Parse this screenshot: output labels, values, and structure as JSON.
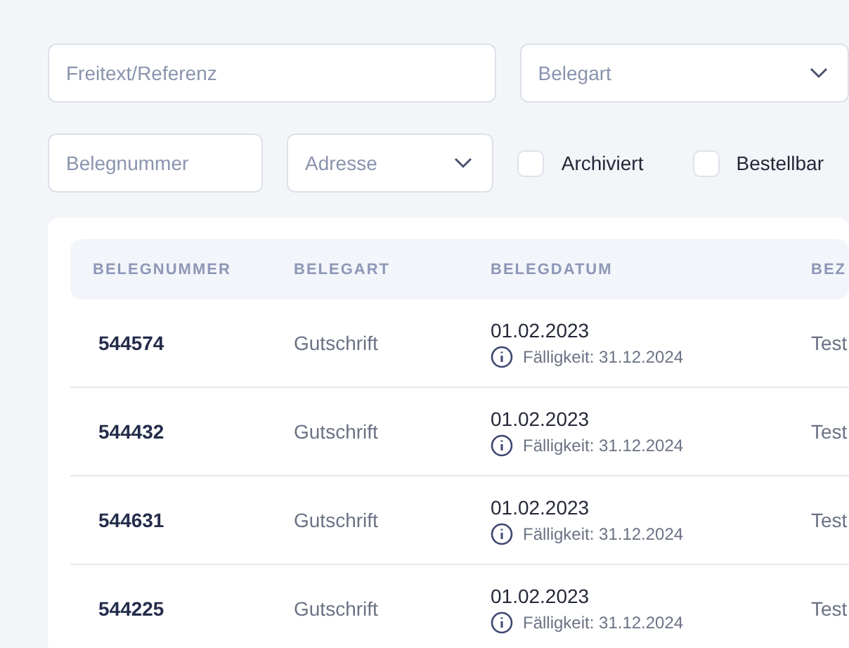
{
  "filters": {
    "freetext": {
      "placeholder": "Freitext/Referenz"
    },
    "type_select": {
      "placeholder": "Belegart"
    },
    "number": {
      "placeholder": "Belegnummer"
    },
    "address_select": {
      "placeholder": "Adresse"
    },
    "checkboxes": [
      {
        "label": "Archiviert",
        "checked": false
      },
      {
        "label": "Bestellbar",
        "checked": false
      }
    ]
  },
  "table": {
    "columns": [
      "BELEGNUMMER",
      "BELEGART",
      "BELEGDATUM",
      "BEZ"
    ],
    "rows": [
      {
        "number": "544574",
        "type": "Gutschrift",
        "date": "01.02.2023",
        "due": "Fälligkeit: 31.12.2024",
        "column_4": "Test"
      },
      {
        "number": "544432",
        "type": "Gutschrift",
        "date": "01.02.2023",
        "due": "Fälligkeit: 31.12.2024",
        "column_4": "Test"
      },
      {
        "number": "544631",
        "type": "Gutschrift",
        "date": "01.02.2023",
        "due": "Fälligkeit: 31.12.2024",
        "column_4": "Test"
      },
      {
        "number": "544225",
        "type": "Gutschrift",
        "date": "01.02.2023",
        "due": "Fälligkeit: 31.12.2024",
        "column_4": "Test"
      }
    ]
  }
}
